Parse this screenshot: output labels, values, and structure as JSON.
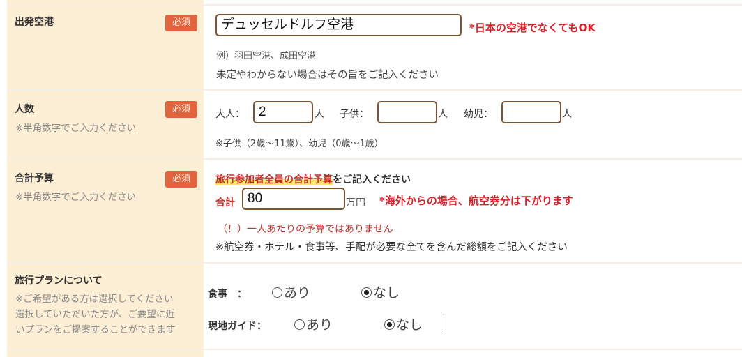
{
  "required_label": "必須",
  "departure": {
    "title": "出発空港",
    "input_value": "デュッセルドルフ空港",
    "note_red": "*日本の空港でなくてもOK",
    "example": "例）羽田空港、成田空港",
    "hint": "未定やわからない場合はその旨をご記入ください"
  },
  "people": {
    "title": "人数",
    "sub": "※半角数字でご入力ください",
    "adult_label": "大人：",
    "adult_value": "2",
    "child_label": "子供：",
    "child_value": "",
    "infant_label": "幼児：",
    "infant_value": "",
    "unit": "人",
    "note": "※子供（2歳〜11歳）、幼児（0歳〜1歳）"
  },
  "budget": {
    "title": "合計予算",
    "sub": "※半角数字でご入力ください",
    "heading_highlight": "旅行参加者全員の合計予算",
    "heading_rest": "をご記入ください",
    "total_label": "合計",
    "value": "80",
    "unit": "万円",
    "note_red": "*海外からの場合、航空券分は下がります",
    "warning": "（！）一人あたりの予算ではありません",
    "note": "※航空券・ホテル・食事等、手配が必要な全てを含んだ総額をご記入ください"
  },
  "plan": {
    "title": "旅行プランについて",
    "sub_lines": [
      "※ご希望がある方は選択してください",
      "選択していただいた方が、ご要望に近",
      "いプランをご提案することができます"
    ],
    "meal": {
      "label": "食事　：",
      "options": [
        "あり",
        "なし"
      ],
      "selected": "なし"
    },
    "guide": {
      "label": "現地ガイド：",
      "options": [
        "あり",
        "なし"
      ],
      "selected": "なし"
    }
  },
  "colors": {
    "label_bg": "#fdeed6",
    "badge": "#e0653e",
    "red": "#d9202b",
    "input_border": "#7a5535"
  }
}
